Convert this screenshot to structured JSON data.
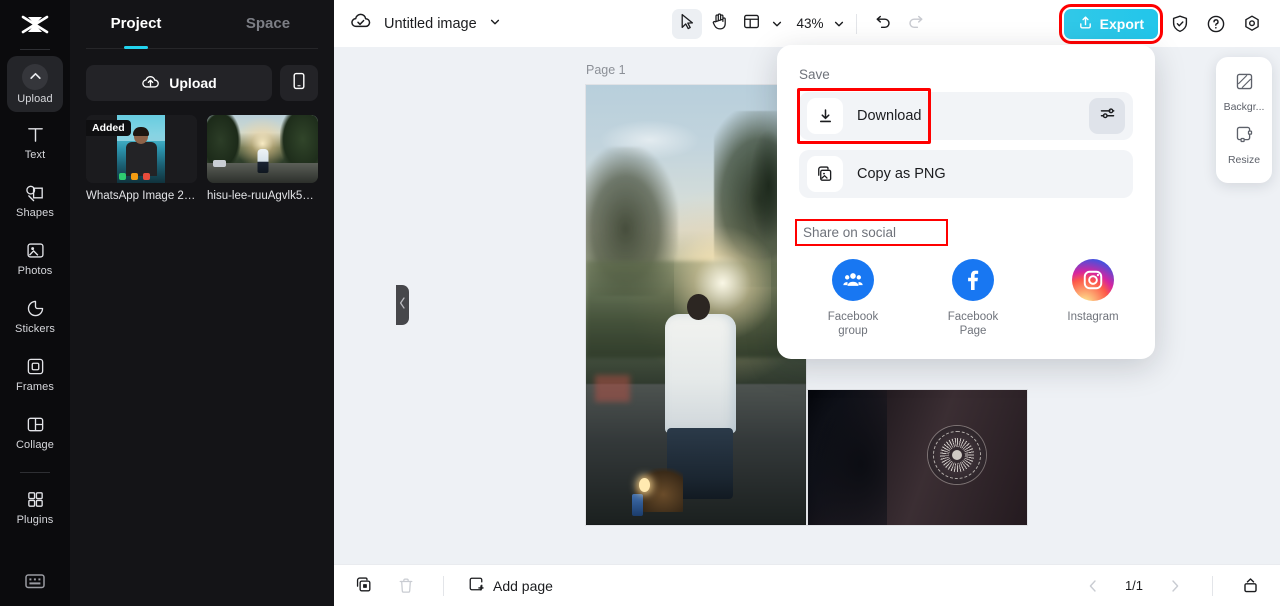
{
  "rail": {
    "logo": "capcut-logo",
    "items": [
      {
        "label": "Upload",
        "icon": "upload-chevron-icon",
        "active": true
      },
      {
        "label": "Text",
        "icon": "text-t-icon",
        "active": false
      },
      {
        "label": "Shapes",
        "icon": "shapes-icon",
        "active": false
      },
      {
        "label": "Photos",
        "icon": "photo-icon",
        "active": false
      },
      {
        "label": "Stickers",
        "icon": "sticker-icon",
        "active": false
      },
      {
        "label": "Frames",
        "icon": "frame-icon",
        "active": false
      },
      {
        "label": "Collage",
        "icon": "collage-icon",
        "active": false
      },
      {
        "label": "Plugins",
        "icon": "plugins-grid-icon",
        "active": false
      }
    ],
    "bottom_icon": "keyboard-shortcuts-icon"
  },
  "panel": {
    "tabs": [
      {
        "label": "Project",
        "active": true
      },
      {
        "label": "Space",
        "active": false
      }
    ],
    "upload_label": "Upload",
    "mobile_upload_icon": "mobile-phone-icon",
    "assets": [
      {
        "name": "WhatsApp Image 20...",
        "badge": "Added"
      },
      {
        "name": "hisu-lee-ruuAgvlk5_...",
        "badge": ""
      }
    ],
    "collapse_icon": "chevron-left-icon"
  },
  "topbar": {
    "cloud_icon": "cloud-saved-icon",
    "title": "Untitled image",
    "title_caret": "chevron-down-icon",
    "tools": [
      {
        "name": "select-tool",
        "icon": "cursor-arrow-icon",
        "selected": true
      },
      {
        "name": "hand-tool",
        "icon": "hand-icon",
        "selected": false
      },
      {
        "name": "layout-tool",
        "icon": "layout-panel-icon",
        "selected": false
      }
    ],
    "layout_caret": "chevron-down-icon",
    "zoom_value": "43%",
    "zoom_caret": "chevron-down-icon",
    "undo_icon": "undo-arrow-icon",
    "redo_icon": "redo-arrow-icon",
    "export_label": "Export",
    "export_icon": "export-upload-icon",
    "export_highlighted": true,
    "right_icons": [
      {
        "name": "shield-check-icon"
      },
      {
        "name": "help-question-icon"
      },
      {
        "name": "settings-gear-icon"
      }
    ]
  },
  "dropdown": {
    "save_heading": "Save",
    "rows": [
      {
        "label": "Download",
        "icon": "download-arrow-icon",
        "trailing_icon": "sliders-settings-icon",
        "highlighted": true
      },
      {
        "label": "Copy as PNG",
        "icon": "copy-image-icon",
        "trailing_icon": "",
        "highlighted": false
      }
    ],
    "social_heading": "Share on social",
    "social_heading_highlighted": true,
    "socials": [
      {
        "label": "Facebook\ngroup",
        "line1": "Facebook",
        "line2": "group",
        "icon": "facebook-group-icon"
      },
      {
        "label": "Facebook\nPage",
        "line1": "Facebook",
        "line2": "Page",
        "icon": "facebook-page-icon"
      },
      {
        "label": "Instagram",
        "line1": "Instagram",
        "line2": "",
        "icon": "instagram-icon"
      }
    ]
  },
  "rightpanel": {
    "items": [
      {
        "label": "Backgr...",
        "icon": "background-icon"
      },
      {
        "label": "Resize",
        "icon": "resize-icon"
      }
    ]
  },
  "canvas": {
    "page_label": "Page 1"
  },
  "bottombar": {
    "duplicate_icon": "duplicate-page-icon",
    "delete_icon": "trash-delete-icon",
    "add_page_label": "Add page",
    "add_page_icon": "add-page-icon",
    "prev_icon": "chevron-left-icon",
    "next_icon": "chevron-right-icon",
    "page_indicator": "1/1",
    "timeline_icon": "pages-panel-icon"
  },
  "colors": {
    "accent": "#22c6ea",
    "highlight": "#ff0000",
    "rail_bg": "#0b0b0d",
    "panel_bg": "#141417",
    "canvas_bg": "#eef1f5",
    "facebook": "#1877f2"
  }
}
